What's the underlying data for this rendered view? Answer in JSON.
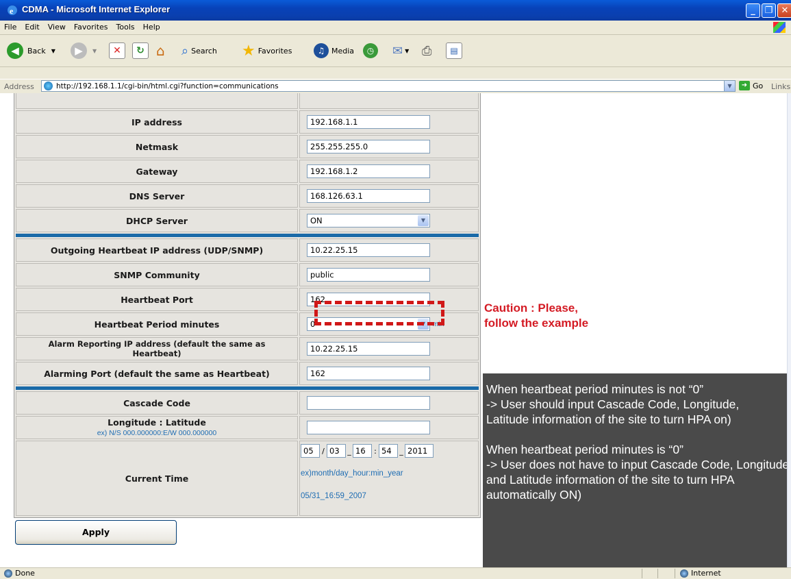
{
  "window": {
    "title": "CDMA - Microsoft Internet Explorer"
  },
  "menu": [
    "File",
    "Edit",
    "View",
    "Favorites",
    "Tools",
    "Help"
  ],
  "toolbar": {
    "back": "Back",
    "search": "Search",
    "favorites": "Favorites",
    "media": "Media"
  },
  "address": {
    "label": "Address",
    "url": "http://192.168.1.1/cgi-bin/html.cgi?function=communications",
    "go": "Go",
    "links": "Links"
  },
  "form": {
    "ip_address": {
      "label": "IP address",
      "value": "192.168.1.1"
    },
    "netmask": {
      "label": "Netmask",
      "value": "255.255.255.0"
    },
    "gateway": {
      "label": "Gateway",
      "value": "192.168.1.2"
    },
    "dns": {
      "label": "DNS Server",
      "value": "168.126.63.1"
    },
    "dhcp": {
      "label": "DHCP Server",
      "value": "ON"
    },
    "hb_ip": {
      "label": "Outgoing Heartbeat IP address (UDP/SNMP)",
      "value": "10.22.25.15"
    },
    "snmp": {
      "label": "SNMP Community",
      "value": "public"
    },
    "hb_port": {
      "label": "Heartbeat Port",
      "value": "162"
    },
    "hb_period": {
      "label": "Heartbeat Period minutes",
      "value": "0",
      "unit": "min"
    },
    "alarm_ip": {
      "label_line1": "Alarm Reporting IP address (default the same as",
      "label_line2": "Heartbeat)",
      "value": "10.22.25.15"
    },
    "alarm_port": {
      "label": "Alarming Port (default the same as Heartbeat)",
      "value": "162"
    },
    "cascade": {
      "label": "Cascade Code",
      "value": ""
    },
    "lonlat": {
      "label": "Longitude : Latitude",
      "hint": "ex) N/S 000.000000:E/W 000.000000",
      "value": ""
    },
    "time": {
      "label": "Current Time",
      "month": "05",
      "sep1": "/",
      "day": "03",
      "sep2": "_",
      "hour": "16",
      "sep3": ":",
      "min": "54",
      "sep4": "_",
      "year": "2011",
      "format_hint": "ex)month/day_hour:min_year",
      "example": "05/31_16:59_2007"
    },
    "apply": "Apply"
  },
  "annotations": {
    "caution_line1": "Caution : Please,",
    "caution_line2": "follow the example",
    "note_lines_a": [
      "When heartbeat period minutes is not “0”",
      "-> User should input Cascade Code, Longitude,",
      "Latitude information of the site to turn HPA on)"
    ],
    "note_lines_b": [
      " When heartbeat period minutes is “0”",
      "-> User does not have to input Cascade Code, Longitude",
      "and Latitude information of the site to turn HPA",
      "automatically ON)"
    ]
  },
  "status": {
    "left": "Done",
    "zone": "Internet"
  },
  "colors": {
    "accent_separator": "#1a6aa8",
    "caution": "#d41b24",
    "note_bg": "#4a4a4a"
  }
}
